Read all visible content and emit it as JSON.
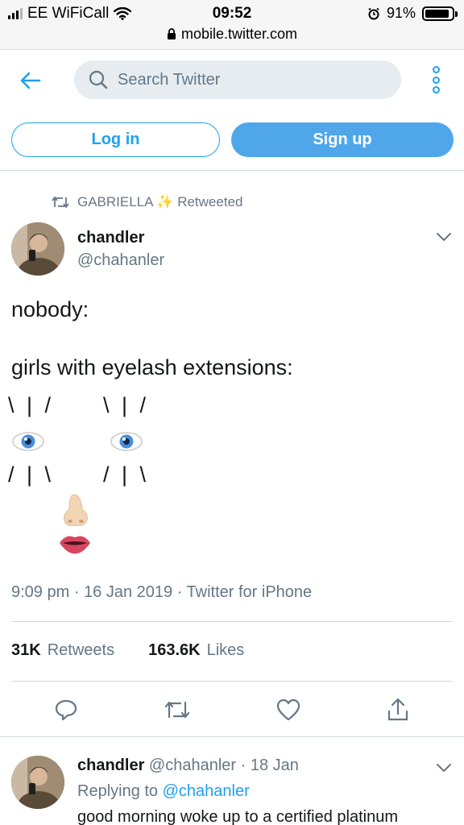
{
  "status_bar": {
    "carrier": "EE WiFiCall",
    "time": "09:52",
    "battery": "91%",
    "battery_level": 0.91,
    "url": "mobile.twitter.com"
  },
  "nav": {
    "search_placeholder": "Search Twitter",
    "login_label": "Log in",
    "signup_label": "Sign up"
  },
  "retweet_context": {
    "retweeter": "GABRIELLA",
    "retweeter_emoji": "✨",
    "label": "Retweeted"
  },
  "tweet": {
    "author_name": "chandler",
    "author_handle": "@chahanler",
    "text_line1": "nobody:",
    "text_line2": "girls with eyelash extensions:",
    "lashes_top": "\\ | /",
    "lashes_bottom": "/ | \\",
    "timestamp": "9:09 pm · 16 Jan 2019 · Twitter for iPhone",
    "retweets_count": "31K",
    "retweets_label": "Retweets",
    "likes_count": "163.6K",
    "likes_label": "Likes"
  },
  "actions": [
    "reply-icon",
    "retweet-icon",
    "like-icon",
    "share-icon"
  ],
  "reply": {
    "author_name": "chandler",
    "author_handle": "@chahanler",
    "date": "· 18 Jan",
    "replying_to_label": "Replying to",
    "replying_to_handle": "@chahanler",
    "text": "good morning woke up to a certified platinum"
  },
  "colors": {
    "accent": "#1da1f2",
    "signup_bg": "#4fa7ea",
    "secondary_text": "#657786",
    "retweet_gold": "#f5b82e"
  }
}
